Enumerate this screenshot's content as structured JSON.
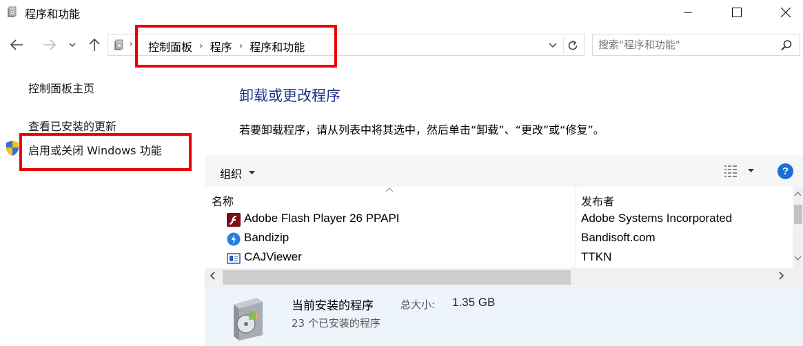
{
  "window": {
    "title": "程序和功能",
    "controls": {
      "minimize": "minimize-icon",
      "maximize": "maximize-icon",
      "close": "close-icon"
    }
  },
  "address_bar": {
    "breadcrumbs": [
      "控制面板",
      "程序",
      "程序和功能"
    ],
    "search_placeholder": "搜索\"程序和功能\""
  },
  "left_pane": {
    "links": [
      "控制面板主页",
      "查看已安装的更新",
      "启用或关闭 Windows 功能"
    ]
  },
  "main": {
    "title": "卸载或更改程序",
    "description": "若要卸载程序，请从列表中将其选中，然后单击“卸载”、“更改”或“修复”。",
    "toolbar": {
      "organize_label": "组织"
    },
    "columns": {
      "name": "名称",
      "publisher": "发布者"
    },
    "programs": [
      {
        "name": "Adobe Flash Player 26 PPAPI",
        "publisher": "Adobe Systems Incorporated",
        "icon": "flash-icon"
      },
      {
        "name": "Bandizip",
        "publisher": "Bandisoft.com",
        "icon": "bandizip-icon"
      },
      {
        "name": "CAJViewer",
        "publisher": "TTKN",
        "icon": "cajviewer-icon"
      }
    ]
  },
  "details": {
    "title": "当前安装的程序",
    "size_label": "总大小:",
    "size_value": "1.35 GB",
    "count_text": "23 个已安装的程序"
  },
  "colors": {
    "title_blue": "#1e3287",
    "highlight_red": "#ee0000",
    "help_blue": "#1c6fd1",
    "details_bg": "#eef4fb"
  }
}
